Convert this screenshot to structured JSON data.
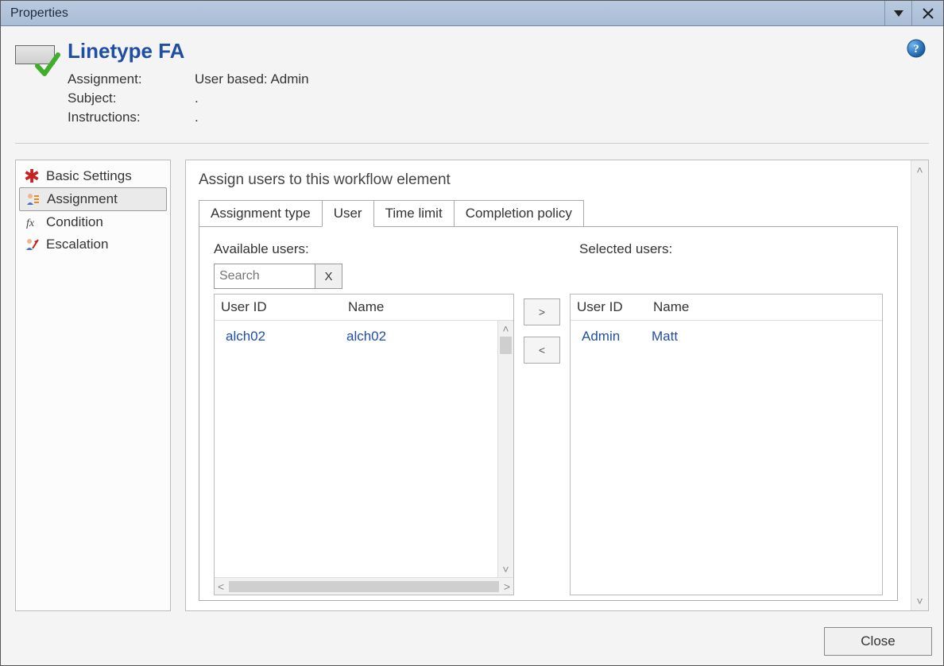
{
  "window": {
    "title": "Properties"
  },
  "header": {
    "title": "Linetype FA",
    "fields": {
      "assignment_label": "Assignment:",
      "assignment_value": "User based: Admin",
      "subject_label": "Subject:",
      "subject_value": ".",
      "instructions_label": "Instructions:",
      "instructions_value": "."
    }
  },
  "sidebar": {
    "items": [
      {
        "label": "Basic Settings"
      },
      {
        "label": "Assignment"
      },
      {
        "label": "Condition"
      },
      {
        "label": "Escalation"
      }
    ],
    "selected_index": 1
  },
  "content": {
    "title": "Assign users to this workflow element",
    "tabs": [
      {
        "label": "Assignment type"
      },
      {
        "label": "User"
      },
      {
        "label": "Time limit"
      },
      {
        "label": "Completion policy"
      }
    ],
    "active_tab_index": 1,
    "available": {
      "label": "Available users:",
      "search_placeholder": "Search",
      "clear_label": "X",
      "columns": {
        "id": "User ID",
        "name": "Name"
      },
      "rows": [
        {
          "id": "alch02",
          "name": "alch02"
        }
      ]
    },
    "selected": {
      "label": "Selected users:",
      "columns": {
        "id": "User ID",
        "name": "Name"
      },
      "rows": [
        {
          "id": "Admin",
          "name": "Matt"
        }
      ]
    },
    "move": {
      "add": ">",
      "remove": "<"
    }
  },
  "footer": {
    "close_label": "Close"
  }
}
